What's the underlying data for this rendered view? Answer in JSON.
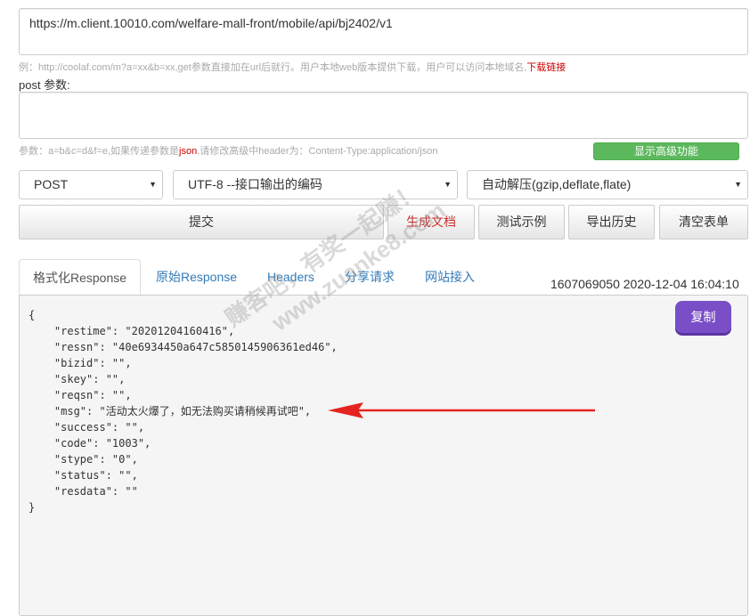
{
  "url_input": {
    "value": "https://m.client.10010.com/welfare-mall-front/mobile/api/bj2402/v1"
  },
  "url_hint": {
    "text": "例：http://coolaf.com/m?a=xx&b=xx,get参数直接加在url后就行。用户本地web版本提供下载，用户可以访问本地域名,",
    "download_link": "下载链接"
  },
  "post_params": {
    "label": "post 参数:",
    "value": ""
  },
  "post_hint": {
    "prefix": "参数：a=b&c=d&f=e,如果传递参数是",
    "json_word": "json",
    "suffix": ",请修改高级中header为：Content-Type:application/json"
  },
  "advanced_button": {
    "label": "显示高级功能",
    "color": "#5cb85c"
  },
  "selects": {
    "method": {
      "value": "POST"
    },
    "encoding": {
      "value": "UTF-8 --接口输出的编码"
    },
    "decompress": {
      "value": "自动解压(gzip,deflate,flate)"
    }
  },
  "buttons": {
    "submit": "提交",
    "generate_doc": "生成文档",
    "test_example": "测试示例",
    "export_history": "导出历史",
    "clear_form": "清空表单"
  },
  "tabs": [
    {
      "label": "格式化Response",
      "active": true
    },
    {
      "label": "原始Response",
      "active": false
    },
    {
      "label": "Headers",
      "active": false
    },
    {
      "label": "分享请求",
      "active": false
    },
    {
      "label": "网站接入",
      "active": false
    }
  ],
  "timestamp": "1607069050 2020-12-04 16:04:10",
  "response": {
    "copy_label": "复制",
    "copy_color": "#7a4ec7",
    "lines": [
      "{",
      "    \"restime\": \"20201204160416\",",
      "    \"ressn\": \"40e6934450a647c5850145906361ed46\",",
      "    \"bizid\": \"\",",
      "    \"skey\": \"\",",
      "    \"reqsn\": \"\",",
      "    \"msg\": \"活动太火爆了，如无法购买请稍候再试吧\",",
      "    \"success\": \"\",",
      "    \"code\": \"1003\",",
      "    \"stype\": \"0\",",
      "    \"status\": \"\",",
      "    \"resdata\": \"\"",
      "}"
    ]
  },
  "annotation_arrow": {
    "color": "#e52420",
    "icon": "arrow-left-icon"
  },
  "watermark": {
    "line1": "赚客吧，有奖一起赚！",
    "line2": "www.zuanke8.com"
  }
}
